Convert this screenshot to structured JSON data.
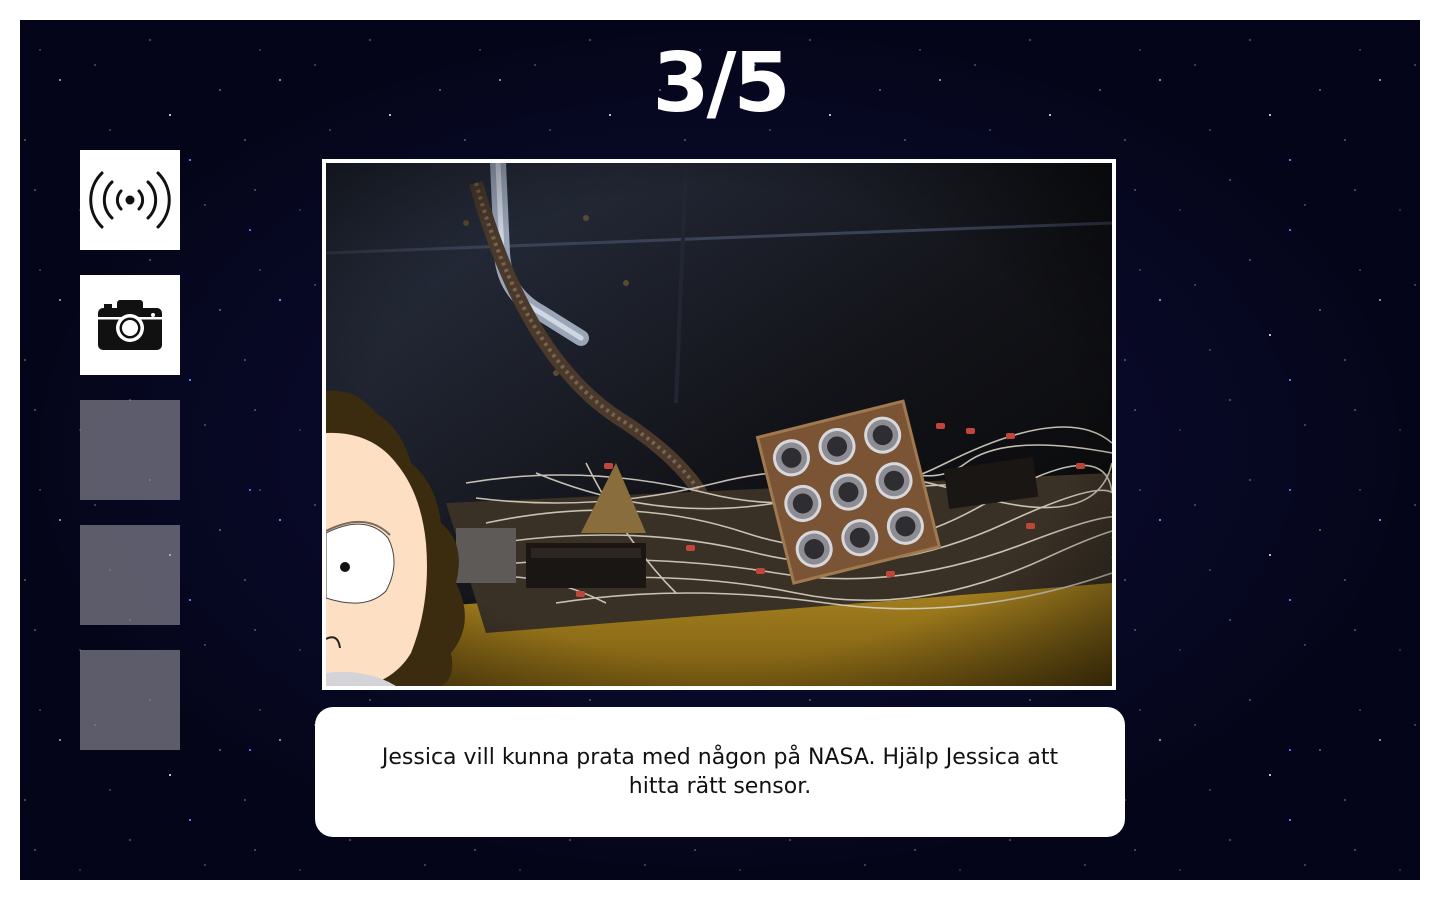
{
  "level": {
    "progress_text": "3/5"
  },
  "toolbar": {
    "tools": [
      {
        "icon": "broadcast-antenna-icon",
        "state": "filled"
      },
      {
        "icon": "camera-icon",
        "state": "filled"
      },
      {
        "icon": "",
        "state": "empty"
      },
      {
        "icon": "",
        "state": "empty"
      },
      {
        "icon": "",
        "state": "empty"
      }
    ]
  },
  "scene": {
    "description_icon": "spacecraft-wiring-sensor-panel",
    "character": "jessica-peeking"
  },
  "dialog": {
    "text": "Jessica vill kunna prata med någon på NASA. Hjälp Jessica att hitta rätt sensor."
  },
  "colors": {
    "background": "#05051a",
    "star_blue": "#4d63ff",
    "tool_empty": "#96969f",
    "frame": "#ffffff"
  }
}
